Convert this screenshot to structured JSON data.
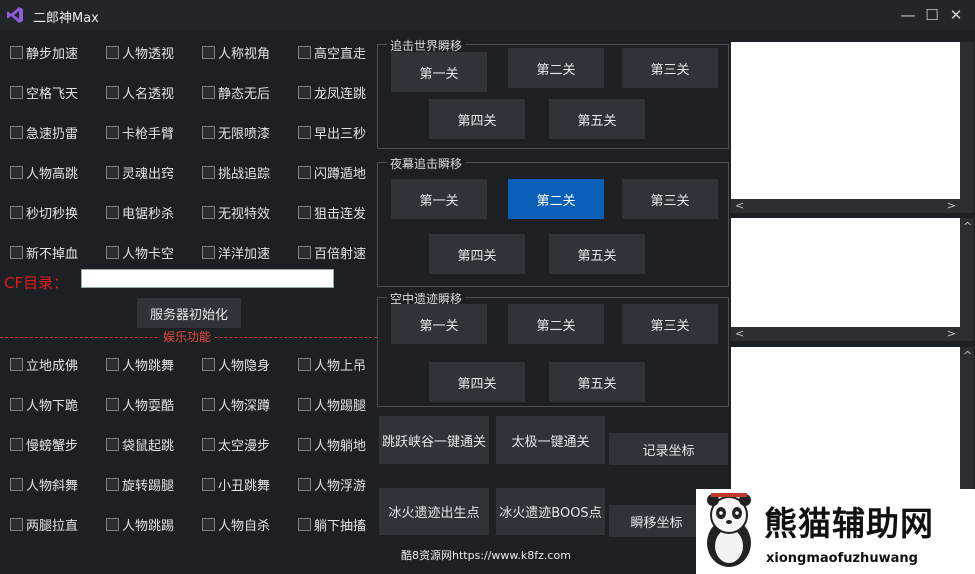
{
  "window": {
    "title": "二郎神Max",
    "minimize_icon": "minimize-icon",
    "maximize_icon": "maximize-icon",
    "close_icon": "close-icon",
    "min_glyph": "—",
    "max_glyph": "☐",
    "close_glyph": "✕"
  },
  "features": {
    "rows": [
      [
        "静步加速",
        "人物透视",
        "人称视角",
        "高空直走"
      ],
      [
        "空格飞天",
        "人名透视",
        "静态无后",
        "龙凤连跳"
      ],
      [
        "急速扔雷",
        "卡枪手臂",
        "无限喷漆",
        "早出三秒"
      ],
      [
        "人物高跳",
        "灵魂出窍",
        "挑战追踪",
        "闪蹲遁地"
      ],
      [
        "秒切秒换",
        "电锯秒杀",
        "无视特效",
        "狙击连发"
      ],
      [
        "新不掉血",
        "人物卡空",
        "洋洋加速",
        "百倍射速"
      ]
    ]
  },
  "cf": {
    "label": "CF目录：",
    "value": "",
    "init_button": "服务器初始化"
  },
  "fun": {
    "section_label": "娱乐功能",
    "rows": [
      [
        "立地成佛",
        "人物跳舞",
        "人物隐身",
        "人物上吊"
      ],
      [
        "人物下跪",
        "人物耍酷",
        "人物深蹲",
        "人物踢腿"
      ],
      [
        "慢螃蟹步",
        "袋鼠起跳",
        "太空漫步",
        "人物躺地"
      ],
      [
        "人物斜舞",
        "旋转踢腿",
        "小丑跳舞",
        "人物浮游"
      ],
      [
        "两腿拉直",
        "人物跳踢",
        "人物自杀",
        "躺下抽搐"
      ]
    ]
  },
  "teleport_groups": [
    {
      "title": "追击世界瞬移",
      "levels": [
        "第一关",
        "第二关",
        "第三关",
        "第四关",
        "第五关"
      ],
      "active": -1
    },
    {
      "title": "夜幕追击瞬移",
      "levels": [
        "第一关",
        "第二关",
        "第三关",
        "第四关",
        "第五关"
      ],
      "active": 1
    },
    {
      "title": "空中遗迹瞬移",
      "levels": [
        "第一关",
        "第二关",
        "第三关",
        "第四关",
        "第五关"
      ],
      "active": -1
    }
  ],
  "actions": {
    "jump_canyon": "跳跃峡谷一键通关",
    "taiji": "太极一键通关",
    "record_coords": "记录坐标",
    "ice_spawn": "冰火遗迹出生点",
    "ice_boss": "冰火遗迹BOOS点",
    "teleport_coords": "瞬移坐标"
  },
  "scroll": {
    "left_arrow": "<",
    "right_arrow": ">",
    "up_arrow": "^"
  },
  "footer": {
    "text": "酷8资源网https://www.k8fz.com"
  },
  "watermark": {
    "cn": "熊猫辅助网",
    "en": "xiongmaofuzhuwang",
    "icon": "panda-logo-icon"
  },
  "colors": {
    "background": "#1c1f24",
    "button": "#2f333a",
    "active": "#0a5fb6",
    "red": "#e01b1b"
  }
}
